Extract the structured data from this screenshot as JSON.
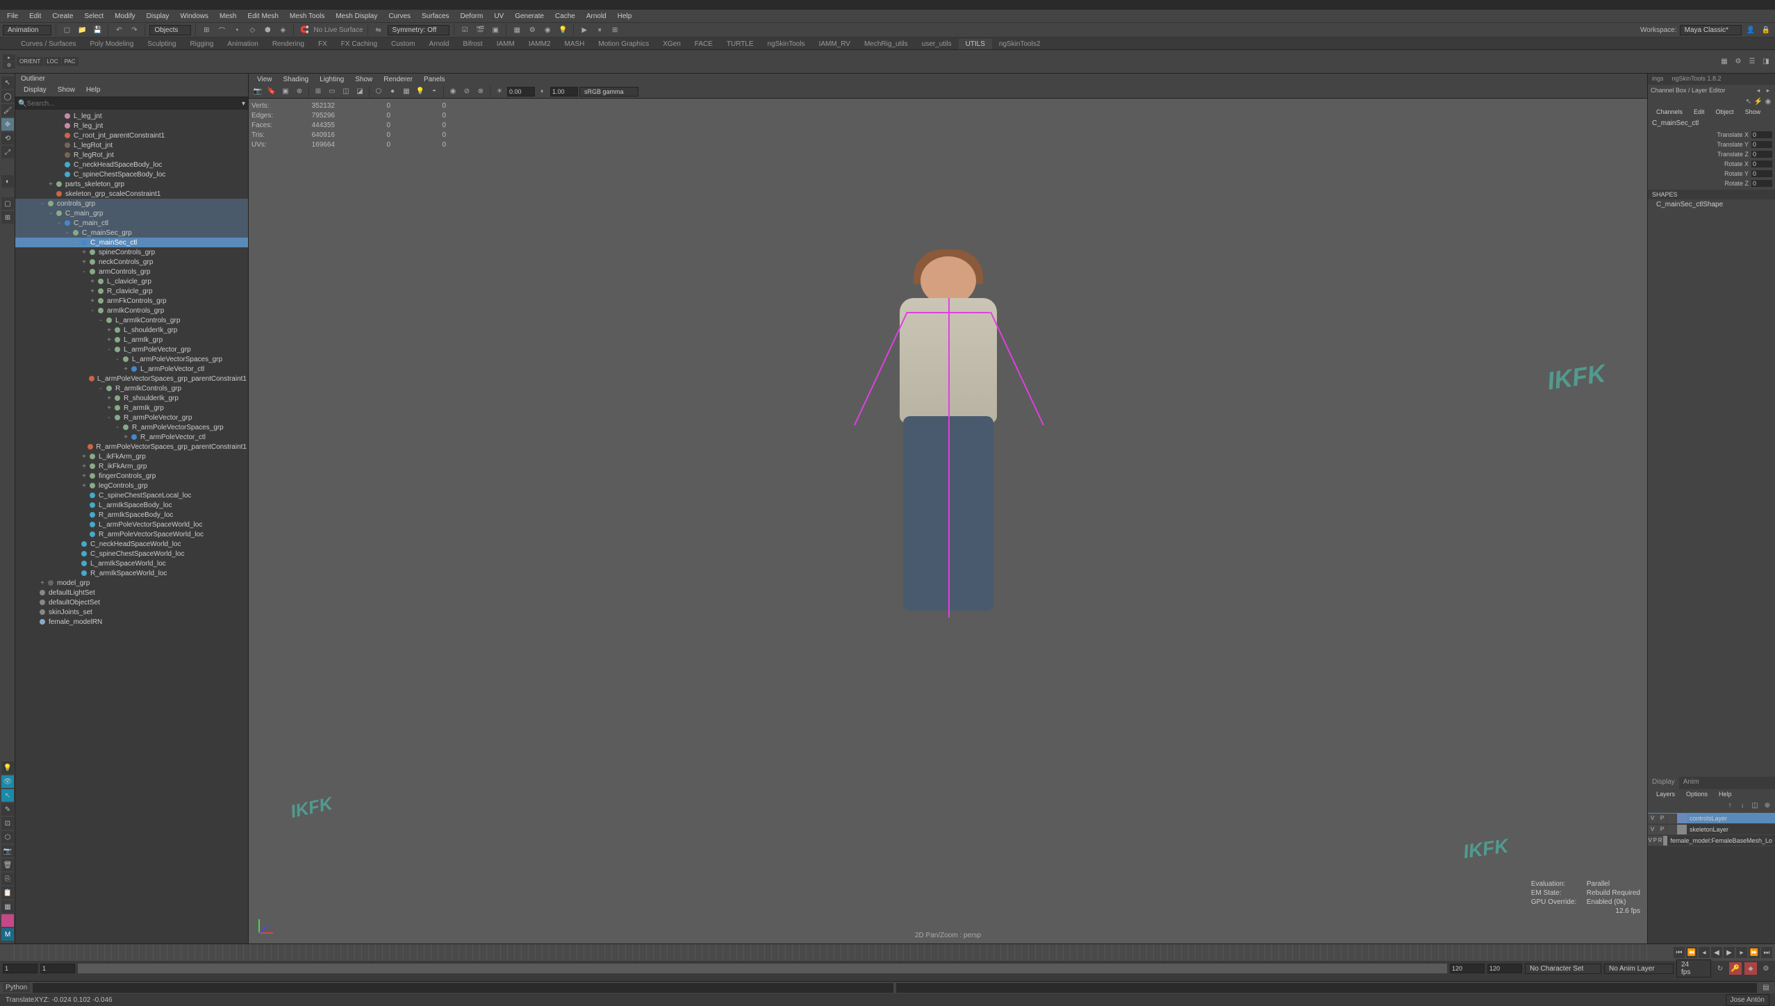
{
  "menubar": [
    "File",
    "Edit",
    "Create",
    "Select",
    "Modify",
    "Display",
    "Windows",
    "Mesh",
    "Edit Mesh",
    "Mesh Tools",
    "Mesh Display",
    "Curves",
    "Surfaces",
    "Deform",
    "UV",
    "Generate",
    "Cache",
    "Arnold",
    "Help"
  ],
  "workspace_label": "Workspace:",
  "workspace_value": "Maya Classic*",
  "module_dropdown": "Animation",
  "objects_label": "Objects",
  "nolive_label": "No Live Surface",
  "symmetry_label": "Symmetry: Off",
  "user_label": "Jose Antón",
  "shelf_tabs": [
    "Curves / Surfaces",
    "Poly Modeling",
    "Sculpting",
    "Rigging",
    "Animation",
    "Rendering",
    "FX",
    "FX Caching",
    "Custom",
    "Arnold",
    "Bifrost",
    "IAMM",
    "IAMM2",
    "MASH",
    "Motion Graphics",
    "XGen",
    "FACE",
    "TURTLE",
    "ngSkinTools",
    "IAMM_RV",
    "MechRig_utils",
    "user_utils",
    "UTILS",
    "ngSkinTools2"
  ],
  "shelf_active": "UTILS",
  "orient_loc": [
    "ORIENT",
    "LOC",
    "PAC"
  ],
  "outliner": {
    "title": "Outliner",
    "menu": [
      "Display",
      "Show",
      "Help"
    ],
    "search_placeholder": "Search..."
  },
  "tree": [
    {
      "d": 3,
      "icon": "joint",
      "label": "L_leg_jnt"
    },
    {
      "d": 3,
      "icon": "joint",
      "label": "R_leg_jnt"
    },
    {
      "d": 3,
      "icon": "constraint",
      "label": "C_root_jnt_parentConstraint1"
    },
    {
      "d": 3,
      "icon": "joint-dim",
      "label": "L_legRot_jnt"
    },
    {
      "d": 3,
      "icon": "joint-dim",
      "label": "R_legRot_jnt"
    },
    {
      "d": 3,
      "icon": "locator",
      "label": "C_neckHeadSpaceBody_loc"
    },
    {
      "d": 3,
      "icon": "locator",
      "label": "C_spineChestSpaceBody_loc"
    },
    {
      "d": 2,
      "icon": "group",
      "label": "parts_skeleton_grp",
      "toggle": "+"
    },
    {
      "d": 2,
      "icon": "constraint",
      "label": "skeleton_grp_scaleConstraint1"
    },
    {
      "d": 1,
      "icon": "group",
      "label": "controls_grp",
      "toggle": "-",
      "hl": true
    },
    {
      "d": 2,
      "icon": "group",
      "label": "C_main_grp",
      "toggle": "-",
      "hl": true
    },
    {
      "d": 3,
      "icon": "ctrl",
      "label": "C_main_ctl",
      "toggle": "-",
      "hl": true
    },
    {
      "d": 4,
      "icon": "group",
      "label": "C_mainSec_grp",
      "toggle": "-",
      "hl": true
    },
    {
      "d": 5,
      "icon": "ctrl",
      "label": "C_mainSec_ctl",
      "toggle": "-",
      "sel": true
    },
    {
      "d": 6,
      "icon": "group",
      "label": "spineControls_grp",
      "toggle": "+"
    },
    {
      "d": 6,
      "icon": "group",
      "label": "neckControls_grp",
      "toggle": "+"
    },
    {
      "d": 6,
      "icon": "group",
      "label": "armControls_grp",
      "toggle": "-"
    },
    {
      "d": 7,
      "icon": "group",
      "label": "L_clavicle_grp",
      "toggle": "+"
    },
    {
      "d": 7,
      "icon": "group",
      "label": "R_clavicle_grp",
      "toggle": "+"
    },
    {
      "d": 7,
      "icon": "group",
      "label": "armFkControls_grp",
      "toggle": "+"
    },
    {
      "d": 7,
      "icon": "group",
      "label": "armIkControls_grp",
      "toggle": "-"
    },
    {
      "d": 8,
      "icon": "group",
      "label": "L_armIkControls_grp",
      "toggle": "-"
    },
    {
      "d": 9,
      "icon": "group",
      "label": "L_shoulderIk_grp",
      "toggle": "+"
    },
    {
      "d": 9,
      "icon": "group",
      "label": "L_armIk_grp",
      "toggle": "+"
    },
    {
      "d": 9,
      "icon": "group",
      "label": "L_armPoleVector_grp",
      "toggle": "-"
    },
    {
      "d": 10,
      "icon": "group",
      "label": "L_armPoleVectorSpaces_grp",
      "toggle": "-"
    },
    {
      "d": 11,
      "icon": "ctrl",
      "label": "L_armPoleVector_ctl",
      "toggle": "+"
    },
    {
      "d": 11,
      "icon": "constraint",
      "label": "L_armPoleVectorSpaces_grp_parentConstraint1"
    },
    {
      "d": 8,
      "icon": "group",
      "label": "R_armIkControls_grp",
      "toggle": "-"
    },
    {
      "d": 9,
      "icon": "group",
      "label": "R_shoulderIk_grp",
      "toggle": "+"
    },
    {
      "d": 9,
      "icon": "group",
      "label": "R_armIk_grp",
      "toggle": "+"
    },
    {
      "d": 9,
      "icon": "group",
      "label": "R_armPoleVector_grp",
      "toggle": "-"
    },
    {
      "d": 10,
      "icon": "group",
      "label": "R_armPoleVectorSpaces_grp",
      "toggle": "-"
    },
    {
      "d": 11,
      "icon": "ctrl",
      "label": "R_armPoleVector_ctl",
      "toggle": "+"
    },
    {
      "d": 11,
      "icon": "constraint",
      "label": "R_armPoleVectorSpaces_grp_parentConstraint1"
    },
    {
      "d": 6,
      "icon": "group",
      "label": "L_ikFkArm_grp",
      "toggle": "+"
    },
    {
      "d": 6,
      "icon": "group",
      "label": "R_ikFkArm_grp",
      "toggle": "+"
    },
    {
      "d": 6,
      "icon": "group",
      "label": "fingerControls_grp",
      "toggle": "+"
    },
    {
      "d": 6,
      "icon": "group",
      "label": "legControls_grp",
      "toggle": "+"
    },
    {
      "d": 6,
      "icon": "locator",
      "label": "C_spineChestSpaceLocal_loc"
    },
    {
      "d": 6,
      "icon": "locator",
      "label": "L_armIkSpaceBody_loc"
    },
    {
      "d": 6,
      "icon": "locator",
      "label": "R_armIkSpaceBody_loc"
    },
    {
      "d": 6,
      "icon": "locator",
      "label": "L_armPoleVectorSpaceWorld_loc"
    },
    {
      "d": 6,
      "icon": "locator",
      "label": "R_armPoleVectorSpaceWorld_loc"
    },
    {
      "d": 5,
      "icon": "locator",
      "label": "C_neckHeadSpaceWorld_loc"
    },
    {
      "d": 5,
      "icon": "locator",
      "label": "C_spineChestSpaceWorld_loc"
    },
    {
      "d": 5,
      "icon": "locator",
      "label": "L_armIkSpaceWorld_loc"
    },
    {
      "d": 5,
      "icon": "locator",
      "label": "R_armIkSpaceWorld_loc"
    },
    {
      "d": 1,
      "icon": "group-dim",
      "label": "model_grp",
      "toggle": "+"
    },
    {
      "d": 0,
      "icon": "set",
      "label": "defaultLightSet"
    },
    {
      "d": 0,
      "icon": "set",
      "label": "defaultObjectSet"
    },
    {
      "d": 0,
      "icon": "set",
      "label": "skinJoints_set"
    },
    {
      "d": 0,
      "icon": "ref",
      "label": "female_modelRN"
    }
  ],
  "viewport_menu": [
    "View",
    "Shading",
    "Lighting",
    "Show",
    "Renderer",
    "Panels"
  ],
  "vp_num1": "0.00",
  "vp_num2": "1.00",
  "vp_gamma": "sRGB gamma",
  "stats": {
    "Verts": [
      "352132",
      "0",
      "0"
    ],
    "Edges": [
      "795296",
      "0",
      "0"
    ],
    "Faces": [
      "444355",
      "0",
      "0"
    ],
    "Tris": [
      "640916",
      "0",
      "0"
    ],
    "UVs": [
      "169664",
      "0",
      "0"
    ]
  },
  "eval": {
    "Evaluation:": "Parallel",
    "EM State:": "Rebuild Required",
    "GPU Override:": "Enabled (0k)",
    "fps": "12.6 fps"
  },
  "camera_label": "2D Pan/Zoom : persp",
  "ikfk_text": "IKFK",
  "right_tabs_top": [
    "ings",
    "ngSkinTools 1.8.2"
  ],
  "right_header": "Channel Box / Layer Editor",
  "channel_menu": [
    "Channels",
    "Edit",
    "Object",
    "Show"
  ],
  "channel_name": "C_mainSec_ctl",
  "attrs": [
    {
      "label": "Translate X",
      "val": "0"
    },
    {
      "label": "Translate Y",
      "val": "0"
    },
    {
      "label": "Translate Z",
      "val": "0"
    },
    {
      "label": "Rotate X",
      "val": "0"
    },
    {
      "label": "Rotate Y",
      "val": "0"
    },
    {
      "label": "Rotate Z",
      "val": "0"
    }
  ],
  "shapes_label": "SHAPES",
  "shape_name": "C_mainSec_ctlShape",
  "layer_tabs": [
    "Display",
    "Anim"
  ],
  "layer_options": [
    "Layers",
    "Options",
    "Help"
  ],
  "layers": [
    {
      "v": "V",
      "p": "P",
      "r": "",
      "color": "#6a8aba",
      "name": "controlsLayer",
      "sel": true
    },
    {
      "v": "V",
      "p": "P",
      "r": "",
      "color": "#888",
      "name": "skeletonLayer"
    },
    {
      "v": "V",
      "p": "P",
      "r": "R",
      "color": "#888",
      "name": "female_model:FemaleBaseMesh_Lo"
    }
  ],
  "timeline": {
    "start": "1",
    "start2": "1",
    "end": "120",
    "end2": "120",
    "current": "1"
  },
  "charset": "No Character Set",
  "animlayer": "No Anim Layer",
  "fps": "24 fps",
  "cmd_label": "Python",
  "status_text": "TranslateXYZ: -0.024    0.102    -0.046"
}
